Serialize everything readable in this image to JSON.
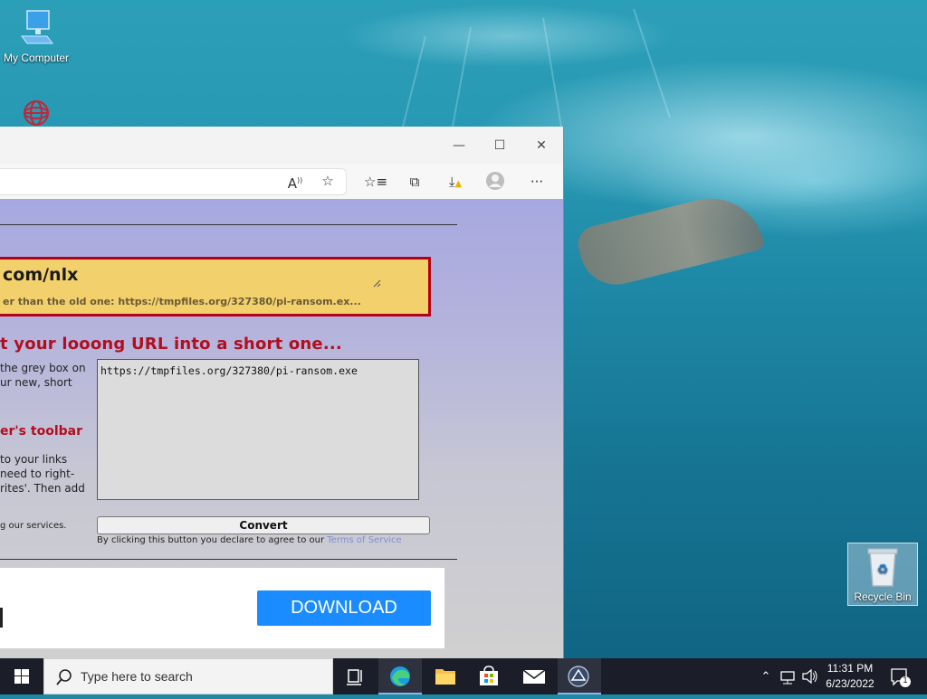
{
  "desktop": {
    "icons": [
      {
        "label": "My Computer"
      },
      {
        "label": ""
      }
    ],
    "recycle_bin": {
      "label": "Recycle Bin"
    }
  },
  "browser": {
    "window_controls": {
      "minimize": "—",
      "maximize": "☐",
      "close": "✕"
    },
    "toolbar_icons": [
      "read-aloud-icon",
      "add-favorite-icon",
      "favorites-icon",
      "collections-icon",
      "downloads-icon",
      "profile-icon",
      "more-icon"
    ]
  },
  "page": {
    "result": {
      "short_url": "com/nlx",
      "subtext": "er than the old one: https://tmpfiles.org/327380/pi-ransom.ex..."
    },
    "heading": "t your looong URL into a short one...",
    "instructions_lines": [
      "the grey box on",
      "ur new, short"
    ],
    "toolbar_heading": "er's toolbar",
    "toolbar_lines": [
      "to your links",
      "need to right-",
      "rites'. Then add"
    ],
    "services_note": "g our services.",
    "long_url_value": "https://tmpfiles.org/327380/pi-ransom.exe",
    "convert_label": "Convert",
    "tos_prefix": "By clicking this button you declare to agree to our",
    "tos_link": "Terms of Service",
    "ad": {
      "download_label": "DOWNLOAD"
    }
  },
  "taskbar": {
    "search_placeholder": "Type here to search",
    "clock_time": "11:31 PM",
    "clock_date": "6/23/2022",
    "notification_count": "1"
  },
  "colors": {
    "heading_red": "#b10f1f",
    "result_yellow": "#f2d06c",
    "download_blue": "#1a8cff",
    "taskbar": "#1b1e29"
  }
}
